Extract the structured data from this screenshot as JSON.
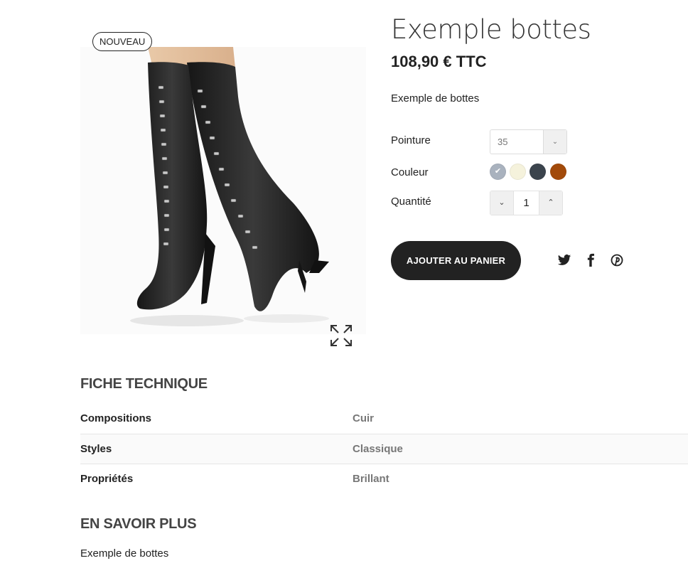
{
  "product": {
    "badge": "NOUVEAU",
    "title": "Exemple bottes",
    "price": "108,90 €",
    "tax_label": "TTC",
    "short_description": "Exemple de bottes"
  },
  "options": {
    "size_label": "Pointure",
    "size_value": "35",
    "color_label": "Couleur",
    "colors": [
      {
        "name": "grey",
        "hex": "#a9b2be",
        "selected": true
      },
      {
        "name": "cream",
        "hex": "#f5f2dc",
        "selected": false
      },
      {
        "name": "dark-slate",
        "hex": "#3b444d",
        "selected": false
      },
      {
        "name": "brown",
        "hex": "#a24a0a",
        "selected": false
      }
    ],
    "quantity_label": "Quantité",
    "quantity_value": "1"
  },
  "actions": {
    "add_to_cart": "AJOUTER AU PANIER",
    "social_icons": [
      "twitter-icon",
      "facebook-icon",
      "pinterest-icon"
    ]
  },
  "specs": {
    "title": "FICHE TECHNIQUE",
    "rows": [
      {
        "name": "Compositions",
        "value": "Cuir"
      },
      {
        "name": "Styles",
        "value": "Classique"
      },
      {
        "name": "Propriétés",
        "value": "Brillant"
      }
    ]
  },
  "more": {
    "title": "EN SAVOIR PLUS",
    "text": "Exemple de bottes"
  },
  "colors": {
    "button_dark": "#222222",
    "text_main": "#222222",
    "text_muted": "#777777"
  }
}
